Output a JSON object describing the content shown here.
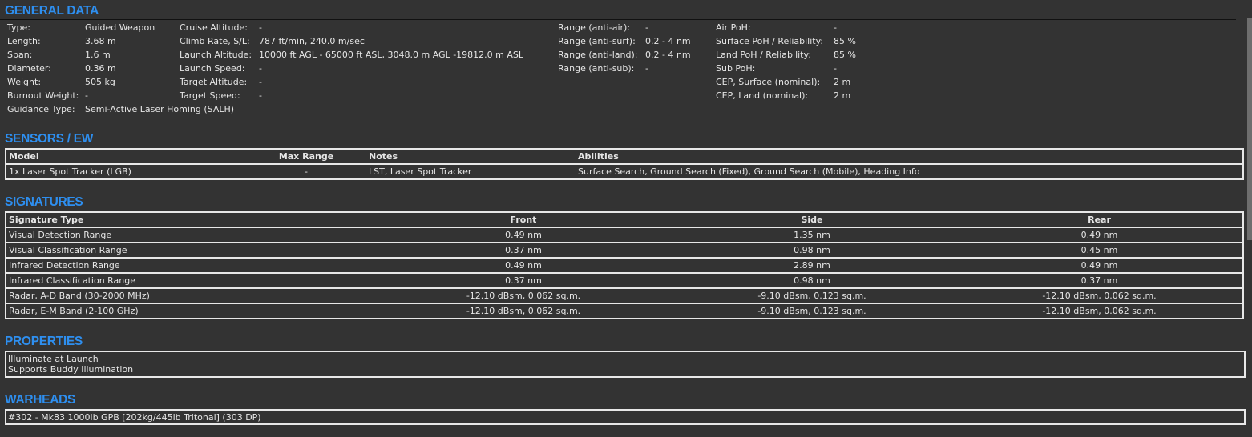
{
  "general": {
    "heading": "GENERAL DATA",
    "col1": [
      {
        "label": "Type:",
        "value": "Guided Weapon"
      },
      {
        "label": "Length:",
        "value": "3.68 m"
      },
      {
        "label": "Span:",
        "value": "1.6 m"
      },
      {
        "label": "Diameter:",
        "value": "0.36 m"
      },
      {
        "label": "Weight:",
        "value": "505 kg"
      },
      {
        "label": "Burnout Weight:",
        "value": "-"
      },
      {
        "label": "Guidance Type:",
        "value": "Semi-Active Laser Homing (SALH)"
      }
    ],
    "col2": [
      {
        "label": "Cruise Altitude:",
        "value": "-"
      },
      {
        "label": "Climb Rate, S/L:",
        "value": "787 ft/min, 240.0 m/sec"
      },
      {
        "label": "Launch Altitude:",
        "value": "10000 ft AGL - 65000 ft ASL, 3048.0 m AGL -19812.0 m ASL"
      },
      {
        "label": "Launch Speed:",
        "value": "-"
      },
      {
        "label": "Target Altitude:",
        "value": "-"
      },
      {
        "label": "Target Speed:",
        "value": "-"
      }
    ],
    "col3": [
      {
        "label": "Range (anti-air):",
        "value": "-"
      },
      {
        "label": "Range (anti-surf):",
        "value": "0.2 - 4 nm"
      },
      {
        "label": "Range (anti-land):",
        "value": "0.2 - 4 nm"
      },
      {
        "label": "Range (anti-sub):",
        "value": "-"
      }
    ],
    "col4": [
      {
        "label": "Air PoH:",
        "value": "-"
      },
      {
        "label": "Surface PoH / Reliability:",
        "value": "85 %"
      },
      {
        "label": "Land PoH / Reliability:",
        "value": "85 %"
      },
      {
        "label": "Sub PoH:",
        "value": "-"
      },
      {
        "label": "CEP, Surface (nominal):",
        "value": "2 m"
      },
      {
        "label": "CEP, Land (nominal):",
        "value": "2 m"
      }
    ]
  },
  "sensors": {
    "heading": "SENSORS / EW",
    "headers": [
      "Model",
      "Max Range",
      "Notes",
      "Abilities"
    ],
    "rows": [
      [
        "1x Laser Spot Tracker (LGB)",
        "-",
        "LST, Laser Spot Tracker",
        "Surface Search, Ground Search (Fixed), Ground Search (Mobile), Heading Info"
      ]
    ]
  },
  "signatures": {
    "heading": "SIGNATURES",
    "headers": [
      "Signature Type",
      "Front",
      "Side",
      "Rear"
    ],
    "rows": [
      [
        "Visual Detection Range",
        "0.49 nm",
        "1.35 nm",
        "0.49 nm"
      ],
      [
        "Visual Classification Range",
        "0.37 nm",
        "0.98 nm",
        "0.45 nm"
      ],
      [
        "Infrared Detection Range",
        "0.49 nm",
        "2.89 nm",
        "0.49 nm"
      ],
      [
        "Infrared Classification Range",
        "0.37 nm",
        "0.98 nm",
        "0.37 nm"
      ],
      [
        "Radar, A-D Band (30-2000 MHz)",
        "-12.10 dBsm, 0.062 sq.m.",
        "-9.10 dBsm, 0.123 sq.m.",
        "-12.10 dBsm, 0.062 sq.m."
      ],
      [
        "Radar, E-M Band (2-100 GHz)",
        "-12.10 dBsm, 0.062 sq.m.",
        "-9.10 dBsm, 0.123 sq.m.",
        "-12.10 dBsm, 0.062 sq.m."
      ]
    ]
  },
  "properties": {
    "heading": "PROPERTIES",
    "items": [
      "Illuminate at Launch",
      "Supports Buddy Illumination"
    ]
  },
  "warheads": {
    "heading": "WARHEADS",
    "items": [
      "#302 - Mk83 1000lb GPB [202kg/445lb Tritonal] (303 DP)"
    ]
  },
  "colors": {
    "background": "#333333",
    "heading": "#2e8ff0",
    "border": "#e8e8e8"
  }
}
